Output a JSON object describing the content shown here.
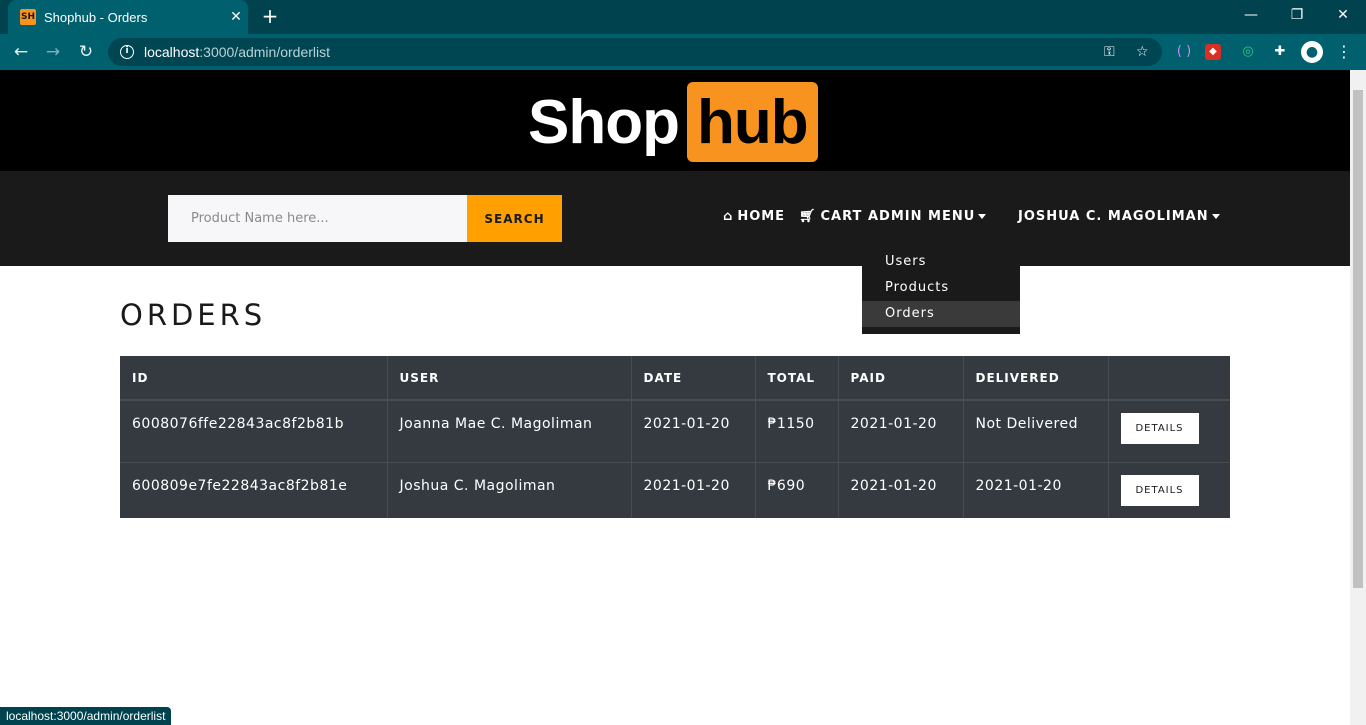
{
  "browser": {
    "tab_title": "Shophub - Orders",
    "favicon_text": "SH",
    "url_host": "localhost",
    "url_rest": ":3000/admin/orderlist",
    "status_url": "localhost:3000/admin/orderlist"
  },
  "logo": {
    "part1": "Shop",
    "part2": "hub"
  },
  "search": {
    "placeholder": "Product Name here...",
    "button_label": "SEARCH"
  },
  "nav": {
    "home": "HOME",
    "cart": "CART",
    "admin_menu": "ADMIN MENU",
    "user": "JOSHUA C. MAGOLIMAN"
  },
  "admin_dropdown": {
    "items": [
      {
        "label": "Users"
      },
      {
        "label": "Products"
      },
      {
        "label": "Orders"
      }
    ]
  },
  "main": {
    "title": "ORDERS",
    "columns": [
      "ID",
      "USER",
      "DATE",
      "TOTAL",
      "PAID",
      "DELIVERED",
      ""
    ],
    "rows": [
      {
        "id": "6008076ffe22843ac8f2b81b",
        "user": "Joanna Mae C. Magoliman",
        "date": "2021-01-20",
        "total": "₱1150",
        "paid": "2021-01-20",
        "delivered": "Not Delivered",
        "action": "DETAILS"
      },
      {
        "id": "600809e7fe22843ac8f2b81e",
        "user": "Joshua C. Magoliman",
        "date": "2021-01-20",
        "total": "₱690",
        "paid": "2021-01-20",
        "delivered": "2021-01-20",
        "action": "DETAILS"
      }
    ]
  },
  "colors": {
    "accent": "#ff9f00",
    "logo_orange": "#f7931e",
    "table_bg": "#343a40",
    "navbar_bg": "#1a1a1a",
    "chrome_teal": "#00606e"
  }
}
